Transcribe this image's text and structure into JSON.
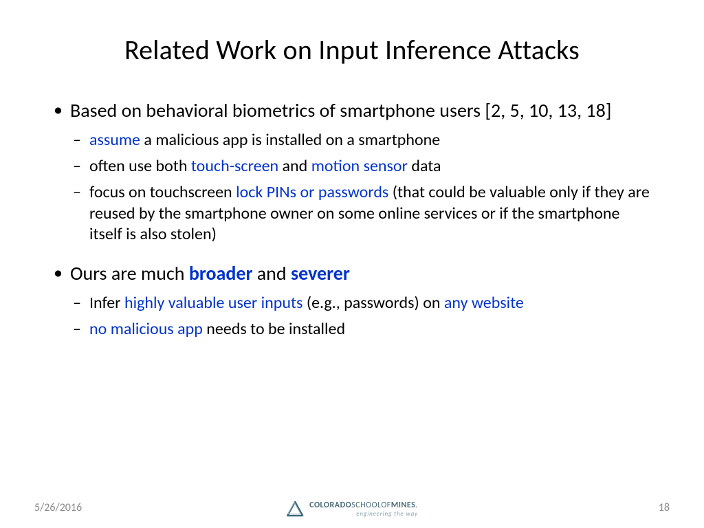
{
  "title": "Related Work on Input Inference Attacks",
  "bullets": {
    "b1": "Based on behavioral biometrics of smartphone users [2, 5, 10, 13, 18]",
    "b1s1_a": "assume",
    "b1s1_b": " a malicious app is installed on a smartphone",
    "b1s2_a": "often use both ",
    "b1s2_b": "touch-screen",
    "b1s2_c": " and ",
    "b1s2_d": "motion sensor",
    "b1s2_e": " data",
    "b1s3_a": "focus on touchscreen ",
    "b1s3_b": "lock PINs or passwords",
    "b1s3_c": " (that could be valuable only if they are reused by the smartphone owner on some online services or if the smartphone itself is also stolen)",
    "b2_a": "Ours are much ",
    "b2_b": "broader",
    "b2_c": " and ",
    "b2_d": "severer",
    "b2s1_a": "Infer ",
    "b2s1_b": "highly valuable user inputs",
    "b2s1_c": " (e.g., passwords) on ",
    "b2s1_d": "any website",
    "b2s2_a": "no malicious app",
    "b2s2_b": " needs to be installed"
  },
  "footer": {
    "date": "5/26/2016",
    "page": "18",
    "logo_line1_a": "COLORADO",
    "logo_line1_b": "SCHOOLOF",
    "logo_line1_c": "MINES",
    "logo_line2": "engineering the way"
  }
}
